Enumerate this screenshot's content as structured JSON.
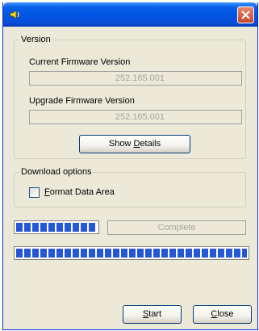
{
  "version_group": {
    "legend": "Version",
    "current_label": "Current Firmware Version",
    "current_value": "252.165.001",
    "upgrade_label": "Upgrade Firmware Version",
    "upgrade_value": "252.165.001",
    "show_details_prefix": "Show ",
    "show_details_accel": "D",
    "show_details_suffix": "etails"
  },
  "download_group": {
    "legend": "Download options",
    "format_accel": "F",
    "format_suffix": "ormat Data Area",
    "format_checked": false
  },
  "progress": {
    "step_fraction": 1.0,
    "status_text": "Complete",
    "total_fraction": 1.0
  },
  "buttons": {
    "start_accel": "S",
    "start_suffix": "tart",
    "close_accel": "C",
    "close_suffix": "lose"
  },
  "colors": {
    "titlebar": "#0054e3",
    "progress_fill": "#2557d6",
    "close_button": "#c6452a"
  },
  "icons": {
    "app": "speaker-icon",
    "close": "close-icon"
  }
}
